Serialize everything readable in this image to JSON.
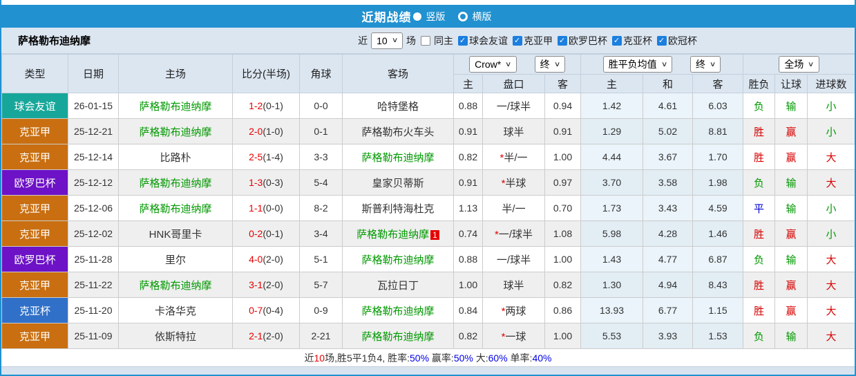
{
  "title_bar": {
    "title": "近期战绩",
    "radios": [
      {
        "label": "竖版",
        "selected": true
      },
      {
        "label": "横版",
        "selected": false
      }
    ]
  },
  "filter_bar": {
    "team_name": "萨格勒布迪纳摩",
    "recent_label": "近",
    "recent_value": "10",
    "recent_suffix": "场",
    "checkboxes": [
      {
        "label": "同主",
        "checked": false
      },
      {
        "label": "球会友谊",
        "checked": true
      },
      {
        "label": "克亚甲",
        "checked": true
      },
      {
        "label": "欧罗巴杯",
        "checked": true
      },
      {
        "label": "克亚杯",
        "checked": true
      },
      {
        "label": "欧冠杯",
        "checked": true
      }
    ]
  },
  "table": {
    "static_headers": [
      "类型",
      "日期",
      "主场",
      "比分(半场)",
      "角球",
      "客场"
    ],
    "selects": {
      "odds_company": "Crow*",
      "odds_stage": "终",
      "avg_type": "胜平负均值",
      "avg_stage": "终",
      "scope": "全场"
    },
    "sub_headers": [
      "主",
      "盘口",
      "客",
      "主",
      "和",
      "客",
      "胜负",
      "让球",
      "进球数"
    ],
    "league_colors": {
      "球会友谊": "#17a79a",
      "克亚甲": "#c96f11",
      "欧罗巴杯": "#6d12c6",
      "克亚杯": "#3070c8"
    },
    "result_color_map": {
      "胜": "red",
      "平": "blue",
      "负": "green",
      "赢": "red",
      "输": "green",
      "走": "blue",
      "大": "red",
      "小": "green"
    },
    "rows": [
      {
        "league": "球会友谊",
        "date": "26-01-15",
        "home": "萨格勒布迪纳摩",
        "home_highlight": true,
        "score": "1-2",
        "half": "(0-1)",
        "corners": "0-0",
        "away": "哈特堡格",
        "away_highlight": false,
        "away_badge": "",
        "odds_home": "0.88",
        "handicap": "一/球半",
        "odds_away": "0.94",
        "avg_win": "1.42",
        "avg_draw": "4.61",
        "avg_lose": "6.03",
        "result": "负",
        "handicap_result": "输",
        "goals_result": "小"
      },
      {
        "league": "克亚甲",
        "date": "25-12-21",
        "home": "萨格勒布迪纳摩",
        "home_highlight": true,
        "score": "2-0",
        "half": "(1-0)",
        "corners": "0-1",
        "away": "萨格勒布火车头",
        "away_highlight": false,
        "away_badge": "",
        "odds_home": "0.91",
        "handicap": "球半",
        "odds_away": "0.91",
        "avg_win": "1.29",
        "avg_draw": "5.02",
        "avg_lose": "8.81",
        "result": "胜",
        "handicap_result": "赢",
        "goals_result": "小"
      },
      {
        "league": "克亚甲",
        "date": "25-12-14",
        "home": "比路朴",
        "home_highlight": false,
        "score": "2-5",
        "half": "(1-4)",
        "corners": "3-3",
        "away": "萨格勒布迪纳摩",
        "away_highlight": true,
        "away_badge": "",
        "odds_home": "0.82",
        "handicap": "*半/一",
        "odds_away": "1.00",
        "avg_win": "4.44",
        "avg_draw": "3.67",
        "avg_lose": "1.70",
        "result": "胜",
        "handicap_result": "赢",
        "goals_result": "大"
      },
      {
        "league": "欧罗巴杯",
        "date": "25-12-12",
        "home": "萨格勒布迪纳摩",
        "home_highlight": true,
        "score": "1-3",
        "half": "(0-3)",
        "corners": "5-4",
        "away": "皇家贝蒂斯",
        "away_highlight": false,
        "away_badge": "",
        "odds_home": "0.91",
        "handicap": "*半球",
        "odds_away": "0.97",
        "avg_win": "3.70",
        "avg_draw": "3.58",
        "avg_lose": "1.98",
        "result": "负",
        "handicap_result": "输",
        "goals_result": "大"
      },
      {
        "league": "克亚甲",
        "date": "25-12-06",
        "home": "萨格勒布迪纳摩",
        "home_highlight": true,
        "score": "1-1",
        "half": "(0-0)",
        "corners": "8-2",
        "away": "斯普利特海杜克",
        "away_highlight": false,
        "away_badge": "",
        "odds_home": "1.13",
        "handicap": "半/一",
        "odds_away": "0.70",
        "avg_win": "1.73",
        "avg_draw": "3.43",
        "avg_lose": "4.59",
        "result": "平",
        "handicap_result": "输",
        "goals_result": "小"
      },
      {
        "league": "克亚甲",
        "date": "25-12-02",
        "home": "HNK哥里卡",
        "home_highlight": false,
        "score": "0-2",
        "half": "(0-1)",
        "corners": "3-4",
        "away": "萨格勒布迪纳摩",
        "away_highlight": true,
        "away_badge": "1",
        "odds_home": "0.74",
        "handicap": "*一/球半",
        "odds_away": "1.08",
        "avg_win": "5.98",
        "avg_draw": "4.28",
        "avg_lose": "1.46",
        "result": "胜",
        "handicap_result": "赢",
        "goals_result": "小"
      },
      {
        "league": "欧罗巴杯",
        "date": "25-11-28",
        "home": "里尔",
        "home_highlight": false,
        "score": "4-0",
        "half": "(2-0)",
        "corners": "5-1",
        "away": "萨格勒布迪纳摩",
        "away_highlight": true,
        "away_badge": "",
        "odds_home": "0.88",
        "handicap": "一/球半",
        "odds_away": "1.00",
        "avg_win": "1.43",
        "avg_draw": "4.77",
        "avg_lose": "6.87",
        "result": "负",
        "handicap_result": "输",
        "goals_result": "大"
      },
      {
        "league": "克亚甲",
        "date": "25-11-22",
        "home": "萨格勒布迪纳摩",
        "home_highlight": true,
        "score": "3-1",
        "half": "(2-0)",
        "corners": "5-7",
        "away": "瓦拉日丁",
        "away_highlight": false,
        "away_badge": "",
        "odds_home": "1.00",
        "handicap": "球半",
        "odds_away": "0.82",
        "avg_win": "1.30",
        "avg_draw": "4.94",
        "avg_lose": "8.43",
        "result": "胜",
        "handicap_result": "赢",
        "goals_result": "大"
      },
      {
        "league": "克亚杯",
        "date": "25-11-20",
        "home": "卡洛华克",
        "home_highlight": false,
        "score": "0-7",
        "half": "(0-4)",
        "corners": "0-9",
        "away": "萨格勒布迪纳摩",
        "away_highlight": true,
        "away_badge": "",
        "odds_home": "0.84",
        "handicap": "*两球",
        "odds_away": "0.86",
        "avg_win": "13.93",
        "avg_draw": "6.77",
        "avg_lose": "1.15",
        "result": "胜",
        "handicap_result": "赢",
        "goals_result": "大"
      },
      {
        "league": "克亚甲",
        "date": "25-11-09",
        "home": "依斯特拉",
        "home_highlight": false,
        "score": "2-1",
        "half": "(2-0)",
        "corners": "2-21",
        "away": "萨格勒布迪纳摩",
        "away_highlight": true,
        "away_badge": "",
        "odds_home": "0.82",
        "handicap": "*一球",
        "odds_away": "1.00",
        "avg_win": "5.53",
        "avg_draw": "3.93",
        "avg_lose": "1.53",
        "result": "负",
        "handicap_result": "输",
        "goals_result": "大"
      }
    ]
  },
  "summary": {
    "segments": [
      {
        "text": "近",
        "color": "dark"
      },
      {
        "text": "10",
        "color": "red"
      },
      {
        "text": "场,胜5平1负4, 胜率:",
        "color": "dark"
      },
      {
        "text": "50%",
        "color": "blue"
      },
      {
        "text": " 赢率:",
        "color": "dark"
      },
      {
        "text": "50%",
        "color": "blue"
      },
      {
        "text": " 大:",
        "color": "dark"
      },
      {
        "text": "60%",
        "color": "blue"
      },
      {
        "text": " 单率:",
        "color": "dark"
      },
      {
        "text": "40%",
        "color": "blue"
      }
    ]
  },
  "colors": {
    "bar_blue": "#2191d0",
    "checkbox_blue": "#1b7fe0",
    "score_red": "#e60000",
    "team_green": "#009900",
    "result_red": "#d60000",
    "result_green": "#009900",
    "result_blue": "#0000d0",
    "summary_blue": "#0000e6"
  }
}
